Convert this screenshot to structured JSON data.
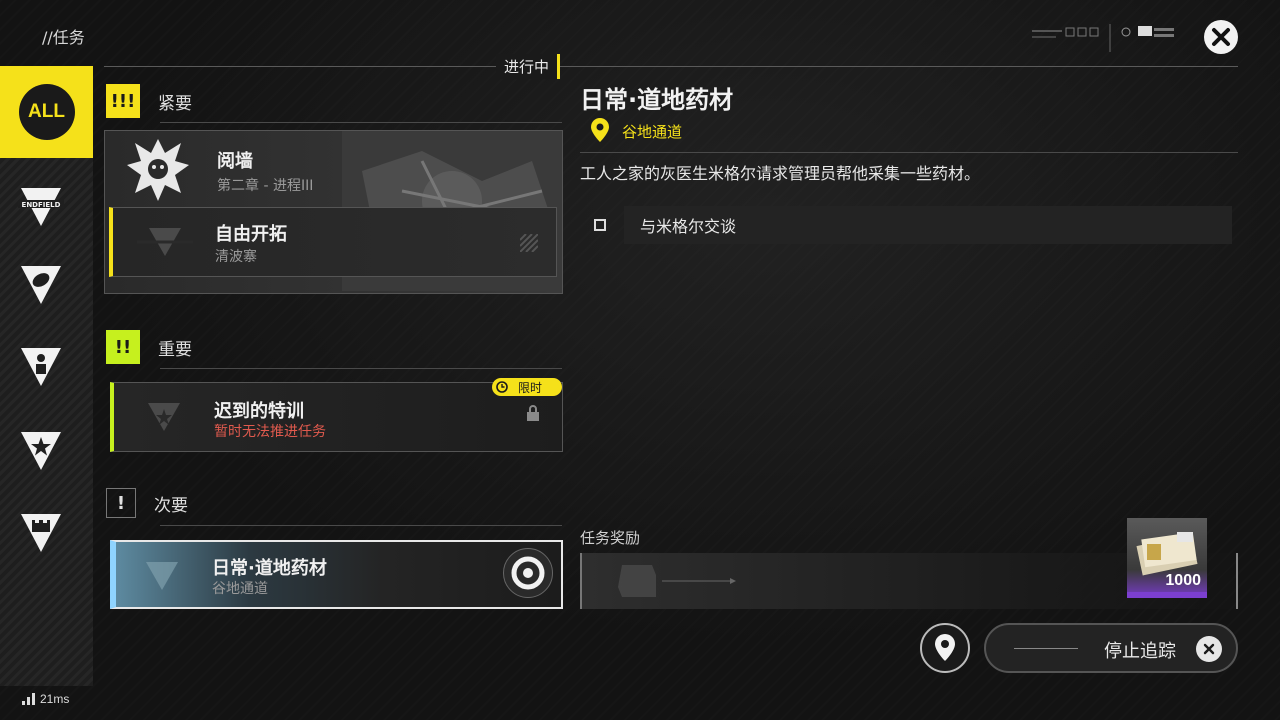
{
  "header": {
    "title": "//任务",
    "status_tag": "进行中"
  },
  "sidebar": {
    "all_label": "ALL",
    "items": [
      {
        "icon": "endfield-icon",
        "label": "ENDFIELD"
      },
      {
        "icon": "leaf-category-icon"
      },
      {
        "icon": "person-category-icon"
      },
      {
        "icon": "star-category-icon"
      },
      {
        "icon": "castle-category-icon"
      }
    ]
  },
  "sections": {
    "urgent": {
      "icon_text": "!!!",
      "label": "紧要"
    },
    "important": {
      "icon_text": "!!",
      "label": "重要"
    },
    "minor": {
      "icon_text": "!",
      "label": "次要"
    }
  },
  "quests": {
    "main": {
      "title": "阅墙",
      "sub": "第二章 - 进程III"
    },
    "explore": {
      "title": "自由开拓",
      "sub": "清波寨"
    },
    "training": {
      "title": "迟到的特训",
      "sub": "暂时无法推进任务",
      "badge": "限时"
    },
    "daily": {
      "title": "日常·道地药材",
      "sub": "谷地通道"
    }
  },
  "detail": {
    "title": "日常·道地药材",
    "location": "谷地通道",
    "description": "工人之家的灰医生米格尔请求管理员帮他采集一些药材。",
    "objectives": [
      {
        "text": "与米格尔交谈"
      }
    ],
    "reward_label": "任务奖励",
    "reward_count": "1000"
  },
  "controls": {
    "stop_tracking": "停止追踪"
  },
  "footer": {
    "ping": "21ms"
  },
  "colors": {
    "accent": "#f5e11a",
    "important": "#c6f01e",
    "warning": "#e05a4e",
    "rare": "#7c3fd0"
  }
}
